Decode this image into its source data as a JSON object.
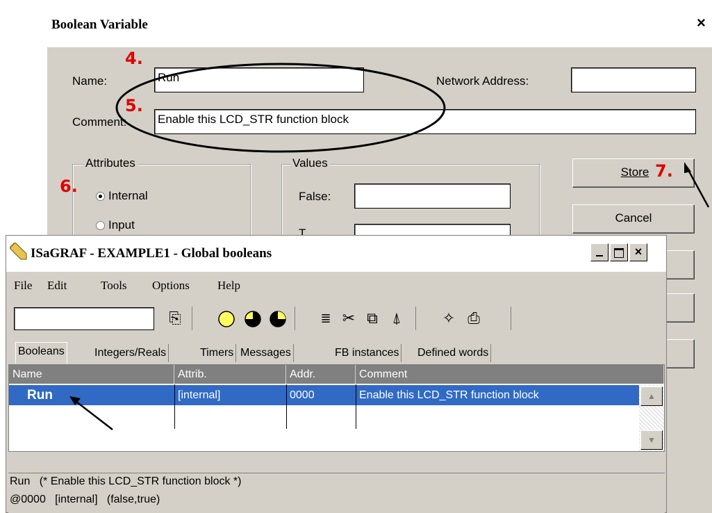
{
  "dialog": {
    "title": "Boolean Variable",
    "close_glyph": "×",
    "name_label": "Name:",
    "name_value": "Run",
    "network_label": "Network Address:",
    "network_value": "",
    "comment_label": "Comment:",
    "comment_value": "Enable this LCD_STR function block",
    "attributes_title": "Attributes",
    "attr_internal": "Internal",
    "attr_input": "Input",
    "values_title": "Values",
    "false_label": "False:",
    "false_value": "",
    "true_label": "T",
    "store_button": "Store",
    "cancel_button": "Cancel"
  },
  "annotations": {
    "step4": "4.",
    "step5": "5.",
    "step6": "6.",
    "step7": "7."
  },
  "window": {
    "title": "ISaGRAF - EXAMPLE1 - Global booleans",
    "menu": [
      "File",
      "Edit",
      "Tools",
      "Options",
      "Help"
    ],
    "search_value": "",
    "tabs": [
      "Booleans",
      "Integers/Reals",
      "Timers",
      "Messages",
      "FB instances",
      "Defined words"
    ],
    "columns": [
      "Name",
      "Attrib.",
      "Addr.",
      "Comment"
    ],
    "rows": [
      {
        "name": "Run",
        "attrib": "[internal]",
        "addr": "0000",
        "comment": "Enable this LCD_STR function block"
      }
    ],
    "status_line1": "Run   (* Enable this LCD_STR function block *)",
    "status_line2": "@0000   [internal]   (false,true)"
  },
  "colors": {
    "selection": "#316ac5",
    "annotation": "#e00000",
    "dialog_bg": "#d4d0c8"
  },
  "icons": [
    "pencil-app-icon",
    "folder-icon",
    "circle-empty-icon",
    "circle-half-icon",
    "circle-quarter-icon",
    "sort-icon",
    "cut-icon",
    "copy-icon",
    "paint-brush-icon",
    "magic-wand-icon",
    "printer-icon"
  ]
}
